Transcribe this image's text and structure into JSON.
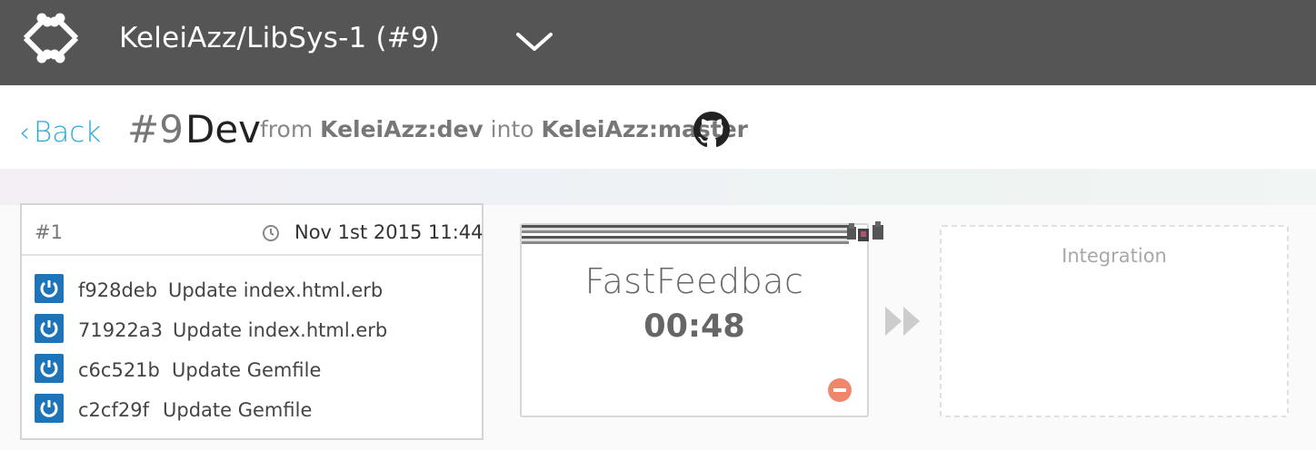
{
  "topbar": {
    "logo_icon": "bones-logo-icon",
    "repo_title": "KeleiAzz/LibSys-1 (#9)",
    "dropdown_icon": "chevron-down-icon"
  },
  "header": {
    "back_label": "Back",
    "pr_number": "#9",
    "pr_name": "Dev",
    "from_word": "from",
    "source_branch": "KeleiAzz:dev",
    "into_word": "into",
    "target_branch": "KeleiAzz:master",
    "github_icon": "github-icon",
    "accent_color": "#29a8e0"
  },
  "build": {
    "id": "#1",
    "timestamp": "Nov 1st 2015 11:44",
    "commits": [
      {
        "sha": "f928deb",
        "message": "Update index.html.erb"
      },
      {
        "sha": "71922a3",
        "message": "Update index.html.erb"
      },
      {
        "sha": "c6c521b",
        "message": "Update Gemfile"
      },
      {
        "sha": "c2cf29f",
        "message": "Update Gemfile"
      }
    ]
  },
  "stage": {
    "name": "FastFeedbac",
    "elapsed": "00:48",
    "cancel_color": "#f0876c"
  },
  "next_stage": {
    "name": "Integration"
  }
}
